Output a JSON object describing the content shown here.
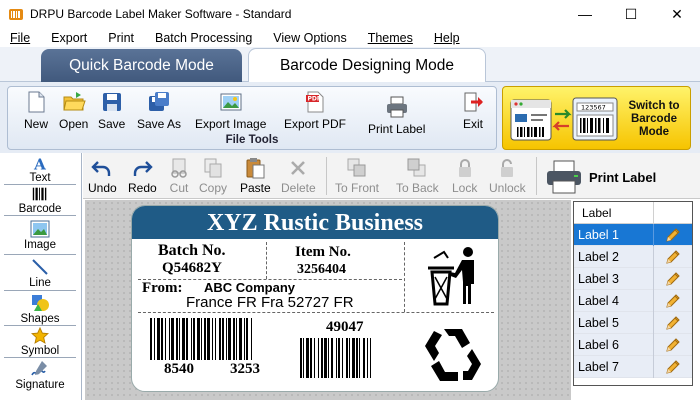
{
  "window": {
    "title": "DRPU Barcode Label Maker Software - Standard",
    "minimize": "—",
    "maximize": "☐",
    "close": "✕"
  },
  "menu": [
    "File",
    "Export",
    "Print",
    "Batch Processing",
    "View Options",
    "Themes",
    "Help"
  ],
  "modes": {
    "quick": "Quick Barcode Mode",
    "design": "Barcode Designing Mode"
  },
  "file_tools": {
    "caption": "File Tools",
    "buttons": [
      "New",
      "Open",
      "Save",
      "Save As",
      "Export Image",
      "Export PDF",
      "Print Label",
      "Exit"
    ]
  },
  "switch": {
    "label": "Switch to Barcode Mode",
    "sample_number": "123567"
  },
  "left_tools": [
    "Text",
    "Barcode",
    "Image",
    "Line",
    "Shapes",
    "Symbol",
    "Signature"
  ],
  "edit_tools": [
    "Undo",
    "Redo",
    "Cut",
    "Copy",
    "Paste",
    "Delete",
    "To Front",
    "To Back",
    "Lock",
    "Unlock"
  ],
  "print_label": "Print Label",
  "label": {
    "header": "XYZ Rustic Business",
    "batch_title": "Batch No.",
    "batch_value": "Q54682Y",
    "item_title": "Item No.",
    "item_value": "3256404",
    "from_title": "From:",
    "company": "ABC Company",
    "address": "France FR Fra 52727 FR",
    "barcode1_left": "8540",
    "barcode1_right": "3253",
    "barcode2_value": "49047"
  },
  "label_list": {
    "header": "Label",
    "items": [
      "Label 1",
      "Label 2",
      "Label 3",
      "Label 4",
      "Label 5",
      "Label 6",
      "Label 7"
    ],
    "selected": 0
  }
}
